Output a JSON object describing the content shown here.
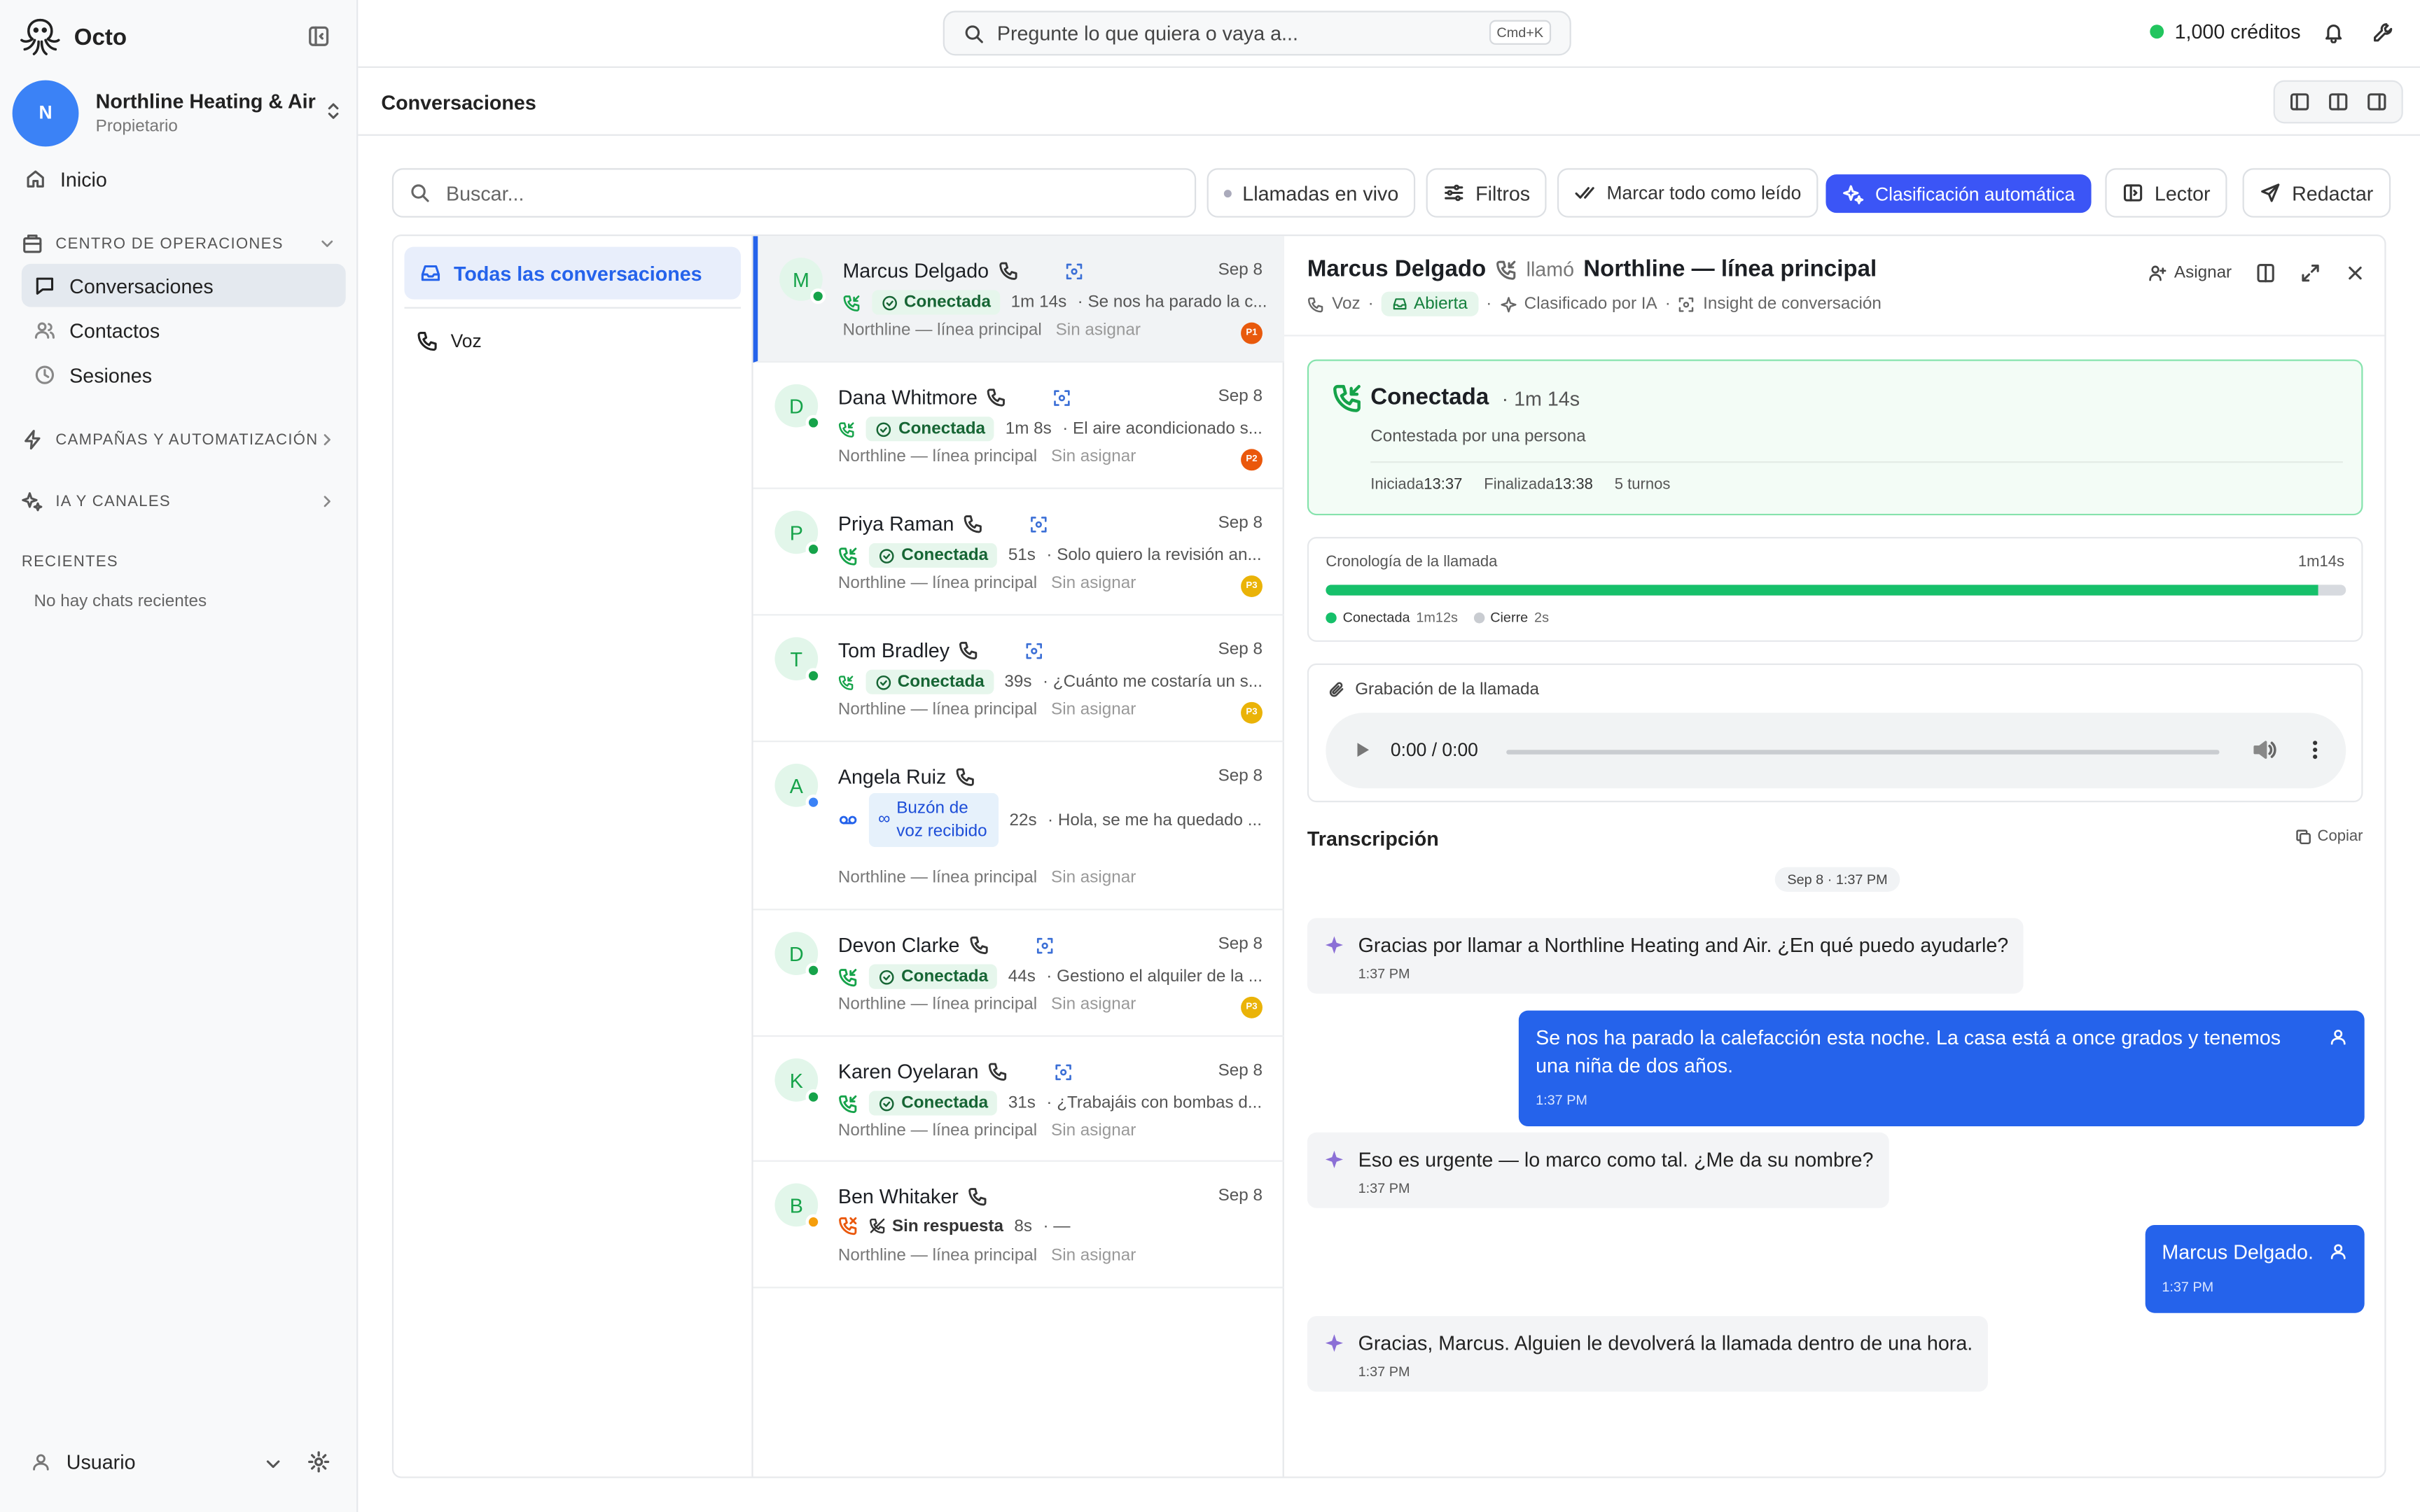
{
  "app": {
    "name": "Octo",
    "org_name": "Northline Heating & Air",
    "org_initial": "N",
    "org_role": "Propietario"
  },
  "sidebar": {
    "home_label": "Inicio",
    "ops_section": "CENTRO DE OPERACIONES",
    "items": [
      {
        "label": "Conversaciones",
        "icon": "chat-icon",
        "active": true
      },
      {
        "label": "Contactos",
        "icon": "users-icon"
      },
      {
        "label": "Sesiones",
        "icon": "clock-icon"
      }
    ],
    "campaigns_section": "CAMPAÑAS Y AUTOMATIZACIÓN",
    "ai_section": "IA Y CANALES",
    "recent_section": "RECIENTES",
    "recent_empty": "No hay chats recientes",
    "user_label": "Usuario"
  },
  "topbar": {
    "search_placeholder": "Pregunte lo que quiera o vaya a...",
    "search_shortcut": "Cmd+K",
    "credits": "1,000 créditos"
  },
  "page": {
    "title": "Conversaciones"
  },
  "toolbar": {
    "search_placeholder": "Buscar...",
    "live_calls": "Llamadas en vivo",
    "filters": "Filtros",
    "mark_all_read": "Marcar todo como leído",
    "auto_classify": "Clasificación automática",
    "reader": "Lector",
    "compose": "Redactar"
  },
  "filters": {
    "all": "Todas las conversaciones",
    "voice": "Voz"
  },
  "conversations": [
    {
      "initial": "M",
      "name": "Marcus Delgado",
      "date": "Sep 8",
      "status": "Conectada",
      "duration": "1m 14s",
      "preview": "· Se nos ha parado la c...",
      "line": "Northline — línea principal",
      "assignee": "Sin asignar",
      "priority": "P1",
      "priority_color": "#e8590c",
      "dot_color": "#16a34a"
    },
    {
      "initial": "D",
      "name": "Dana Whitmore",
      "date": "Sep 8",
      "status": "Conectada",
      "duration": "1m 8s",
      "preview": "· El aire acondicionado s...",
      "line": "Northline — línea principal",
      "assignee": "Sin asignar",
      "priority": "P2",
      "priority_color": "#ea580c",
      "dot_color": "#16a34a"
    },
    {
      "initial": "P",
      "name": "Priya Raman",
      "date": "Sep 8",
      "status": "Conectada",
      "duration": "51s",
      "preview": "· Solo quiero la revisión an...",
      "line": "Northline — línea principal",
      "assignee": "Sin asignar",
      "priority": "P3",
      "priority_color": "#eab308",
      "dot_color": "#16a34a"
    },
    {
      "initial": "T",
      "name": "Tom Bradley",
      "date": "Sep 8",
      "status": "Conectada",
      "duration": "39s",
      "preview": "· ¿Cuánto me costaría un s...",
      "line": "Northline — línea principal",
      "assignee": "Sin asignar",
      "priority": "P3",
      "priority_color": "#eab308",
      "dot_color": "#16a34a"
    },
    {
      "initial": "A",
      "name": "Angela Ruiz",
      "date": "Sep 8",
      "status": "Buzón de voz recibido",
      "duration": "22s",
      "preview": "· Hola, se me ha quedado ...",
      "line": "Northline — línea principal",
      "assignee": "Sin asignar",
      "priority": "",
      "dot_color": "#3b82f6"
    },
    {
      "initial": "D",
      "name": "Devon Clarke",
      "date": "Sep 8",
      "status": "Conectada",
      "duration": "44s",
      "preview": "· Gestiono el alquiler de la ...",
      "line": "Northline — línea principal",
      "assignee": "Sin asignar",
      "priority": "P3",
      "priority_color": "#eab308",
      "dot_color": "#16a34a"
    },
    {
      "initial": "K",
      "name": "Karen Oyelaran",
      "date": "Sep 8",
      "status": "Conectada",
      "duration": "31s",
      "preview": "· ¿Trabajáis con bombas d...",
      "line": "Northline — línea principal",
      "assignee": "Sin asignar",
      "priority": "",
      "dot_color": "#16a34a"
    },
    {
      "initial": "B",
      "name": "Ben Whitaker",
      "date": "Sep 8",
      "status": "Sin respuesta",
      "duration": "8s",
      "preview": "· —",
      "line": "Northline — línea principal",
      "assignee": "Sin asignar",
      "priority": "",
      "dot_color": "#f59e0b"
    }
  ],
  "detail": {
    "caller": "Marcus Delgado",
    "verb": "llamó",
    "line": "Northline — línea principal",
    "channel": "Voz",
    "state": "Abierta",
    "classified": "Clasificado por IA",
    "insight": "Insight de conversación",
    "assign": "Asignar",
    "call": {
      "status": "Conectada",
      "duration": "· 1m 14s",
      "answered_by": "Contestada por una persona",
      "started_label": "Iniciada",
      "started": "13:37",
      "ended_label": "Finalizada",
      "ended": "13:38",
      "turns": "5 turnos"
    },
    "timeline": {
      "title": "Cronología de la llamada",
      "total": "1m14s",
      "connected_label": "Conectada",
      "connected": "1m12s",
      "closing_label": "Cierre",
      "closing": "2s",
      "connected_fraction": 0.973
    },
    "recording": {
      "title": "Grabación de la llamada",
      "time": "0:00 / 0:00"
    },
    "transcript": {
      "title": "Transcripción",
      "copy": "Copiar",
      "date": "Sep 8 · 1:37 PM",
      "messages": [
        {
          "role": "ai",
          "text": "Gracias por llamar a Northline Heating and Air. ¿En qué puedo ayudarle?",
          "time": "1:37 PM"
        },
        {
          "role": "user",
          "text": "Se nos ha parado la calefacción esta noche. La casa está a once grados y tenemos una niña de dos años.",
          "time": "1:37 PM"
        },
        {
          "role": "ai",
          "text": "Eso es urgente — lo marco como tal. ¿Me da su nombre?",
          "time": "1:37 PM"
        },
        {
          "role": "user",
          "text": "Marcus Delgado.",
          "time": "1:37 PM"
        },
        {
          "role": "ai",
          "text": "Gracias, Marcus. Alguien le devolverá la llamada dentro de una hora.",
          "time": "1:37 PM"
        }
      ]
    }
  }
}
